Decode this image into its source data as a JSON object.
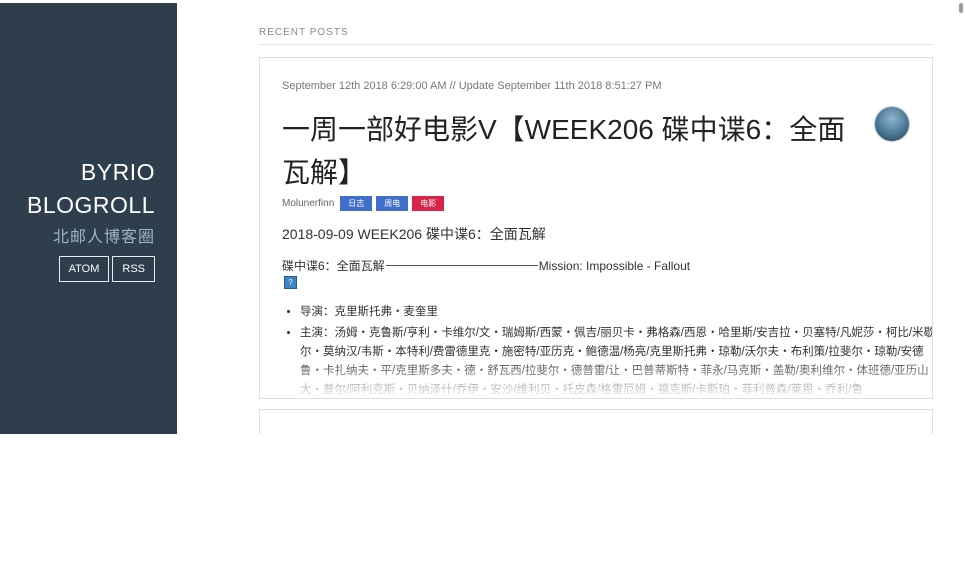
{
  "sidebar": {
    "brand_line1": "BYRIO",
    "brand_line2": "BLOGROLL",
    "subtitle": "北邮人博客圈",
    "buttons": [
      "ATOM",
      "RSS"
    ],
    "background": "#2e3e4d"
  },
  "main": {
    "section_title": "RECENT POSTS",
    "post": {
      "meta": "September 12th 2018 6:29:00 AM // Update September 11th 2018 8:51:27 PM",
      "title": "一周一部好电影V【WEEK206 碟中谍6：全面瓦解】",
      "author": "Molunerfinn",
      "tags": [
        {
          "label": "日志",
          "color": "#3f6fc9"
        },
        {
          "label": "周电",
          "color": "#3f6fc9"
        },
        {
          "label": "电影",
          "color": "#d9254a"
        }
      ],
      "subheading": "2018-09-09 WEEK206 碟中谍6：全面瓦解",
      "line_left": "碟中谍6：全面瓦解",
      "line_right": "Mission: Impossible - Fallout",
      "image_icon": "?",
      "credits": [
        "导演：克里斯托弗・麦奎里",
        "主演：汤姆・克鲁斯/亨利・卡维尔/文・瑞姆斯/西蒙・佩吉/丽贝卡・弗格森/西恩・哈里斯/安吉拉・贝塞特/凡妮莎・柯比/米歇尔・莫纳汉/韦斯・本特利/费雷德里克・施密特/亚历克・鲍德温/杨亮/克里斯托弗・琼勒/沃尔夫・布利策/拉斐尔・琼勒/安德鲁・卡扎纳夫・平/克里斯多夫・德・舒瓦西/拉斐尔・德普雷/让・巴普蒂斯特・菲永/马克斯・盖勒/奥利维尔・体班德/亚历山大・普尔/阿利克斯・贝纳泽什/乔伊・安沙/维利贝・托皮森/格雷厄姆・福克斯/卡斯珀・菲利普森/莱恩・乔利/鲁"
      ]
    }
  }
}
